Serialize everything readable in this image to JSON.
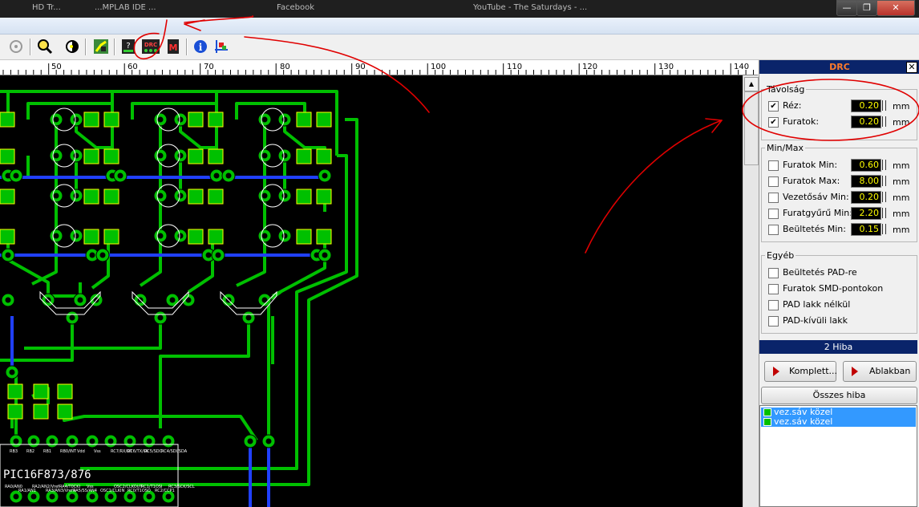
{
  "titlebar": {
    "tabs": [
      "HD Tr...",
      "...MPLAB IDE ...",
      "Facebook",
      "YouTube - The Saturdays - ..."
    ],
    "buttons": [
      "—",
      "❐",
      "✕"
    ]
  },
  "ruler": {
    "ticks": [
      "50",
      "60",
      "70",
      "80",
      "90",
      "100",
      "110",
      "120",
      "130",
      "140"
    ]
  },
  "canvas": {
    "chip_label": "PIC16F873/876",
    "pin_labels_top": [
      "RB3",
      "RB2",
      "RB1",
      "RB0/INT",
      "Vdd",
      "Vss",
      "RC7/RX/DT",
      "RC6/TX/CK",
      "RC5/SDO",
      "RC4/SDI/SDA"
    ],
    "pin_labels_bottom": [
      "RA0/AN0",
      "RA1/AN1",
      "RA2/AN2/Vref-",
      "RA3/AN3/Vref+",
      "RA4/T0CKI",
      "RA5/SS/AN4",
      "Vss",
      "OSC1/CLKIN",
      "OSC2/CLKOUT",
      "RC0/T1OSO",
      "RC1/T1OSI",
      "RC2/CCP1",
      "RC3/SCK/SCL"
    ]
  },
  "drc": {
    "title": "DRC",
    "close": "✕",
    "tavolsag": {
      "legend": "Távolság",
      "rows": [
        {
          "label": "Réz:",
          "checked": true,
          "value": "0.20",
          "unit": "mm"
        },
        {
          "label": "Furatok:",
          "checked": true,
          "value": "0.20",
          "unit": "mm"
        }
      ]
    },
    "minmax": {
      "legend": "Min/Max",
      "rows": [
        {
          "label": "Furatok Min:",
          "checked": false,
          "value": "0.60",
          "unit": "mm"
        },
        {
          "label": "Furatok Max:",
          "checked": false,
          "value": "8.00",
          "unit": "mm"
        },
        {
          "label": "Vezetősáv Min:",
          "checked": false,
          "value": "0.20",
          "unit": "mm"
        },
        {
          "label": "Furatgyűrű Min:",
          "checked": false,
          "value": "2.20",
          "unit": "mm"
        },
        {
          "label": "Beültetés Min:",
          "checked": false,
          "value": "0.15",
          "unit": "mm"
        }
      ]
    },
    "egyeb": {
      "legend": "Egyéb",
      "rows": [
        {
          "label": "Beültetés PAD-re",
          "checked": false
        },
        {
          "label": "Furatok SMD-pontokon",
          "checked": false
        },
        {
          "label": "PAD lakk nélkül",
          "checked": false
        },
        {
          "label": "PAD-kívüli lakk",
          "checked": false
        }
      ]
    },
    "error_count": "2 Hiba",
    "btn_complete": "Komplett...",
    "btn_window": "Ablakban",
    "btn_all": "Összes hiba",
    "errors": [
      "vez.sáv közel",
      "vez.sáv közel"
    ]
  },
  "colors": {
    "copper": "#00c000",
    "track_blue": "#2040ff",
    "pad_outline": "#ffff00",
    "annotation": "#e00000"
  }
}
